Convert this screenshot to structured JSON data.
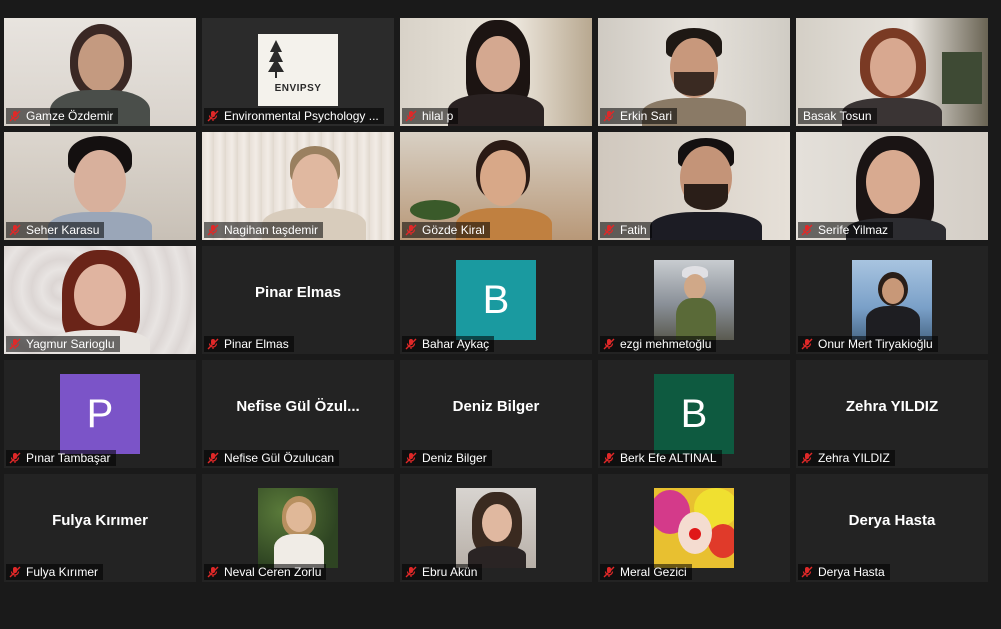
{
  "participants": [
    {
      "name": "Gamze Özdemir",
      "type": "video"
    },
    {
      "name": "Environmental Psychology ...",
      "type": "video",
      "logo_text": "ENVIPSY"
    },
    {
      "name": "hilal p",
      "type": "video"
    },
    {
      "name": "Erkin Sari",
      "type": "video"
    },
    {
      "name": "Basak Tosun",
      "type": "video",
      "active_speaker": true
    },
    {
      "name": "Seher Karasu",
      "type": "video"
    },
    {
      "name": "Nagihan taşdemir",
      "type": "video"
    },
    {
      "name": "Gözde Kiral",
      "type": "video"
    },
    {
      "name": "Fatih",
      "type": "video"
    },
    {
      "name": "Serife Yilmaz",
      "type": "video"
    },
    {
      "name": "Yagmur Sarioglu",
      "type": "video"
    },
    {
      "name": "Pinar Elmas",
      "type": "name",
      "display": "Pinar Elmas"
    },
    {
      "name": "Bahar Aykaç",
      "type": "letter",
      "letter": "B",
      "color": "#1a9aa0"
    },
    {
      "name": "ezgi mehmetoğlu",
      "type": "photo"
    },
    {
      "name": "Onur Mert Tiryakioğlu",
      "type": "photo"
    },
    {
      "name": "Pınar Tambaşar",
      "type": "letter",
      "letter": "P",
      "color": "#7b54c8"
    },
    {
      "name": "Nefise Gül Özulucan",
      "type": "name",
      "display": "Nefise Gül Özul..."
    },
    {
      "name": "Deniz Bilger",
      "type": "name",
      "display": "Deniz Bilger"
    },
    {
      "name": "Berk Efe ALTINAL",
      "type": "letter",
      "letter": "B",
      "color": "#0e5a40"
    },
    {
      "name": "Zehra YILDIZ",
      "type": "name",
      "display": "Zehra YILDIZ"
    },
    {
      "name": "Fulya Kırımer",
      "type": "name",
      "display": "Fulya Kırımer"
    },
    {
      "name": "Neval Ceren Zorlu",
      "type": "photo"
    },
    {
      "name": "Ebru Akün",
      "type": "photo"
    },
    {
      "name": "Meral Gezici",
      "type": "photo"
    },
    {
      "name": "Derya Hasta",
      "type": "name",
      "display": "Derya Hasta"
    }
  ],
  "icons": {
    "muted": "mic-muted-icon",
    "muted_color": "#e02828"
  },
  "colors": {
    "active_border": "#a8d84a",
    "tile_bg": "#232323",
    "app_bg": "#1a1a1a"
  }
}
